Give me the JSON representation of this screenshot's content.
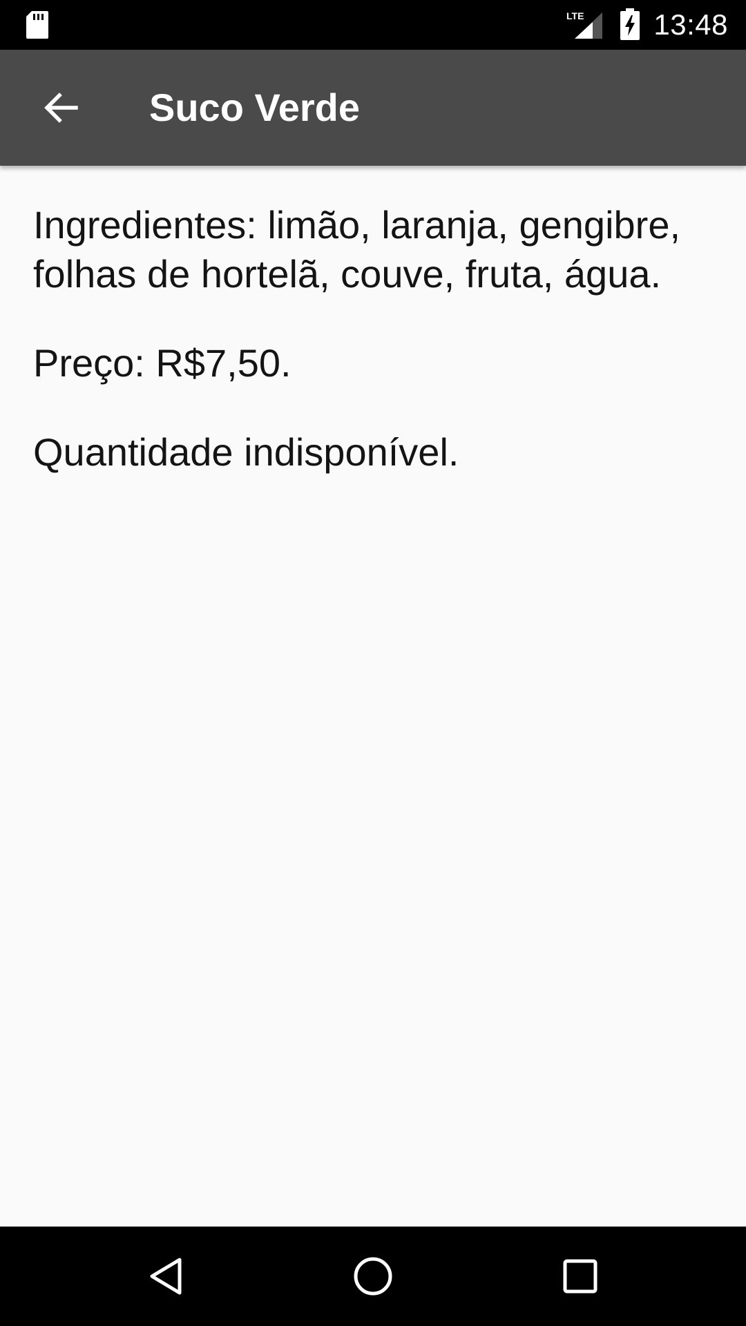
{
  "status_bar": {
    "time": "13:48",
    "network_label": "LTE",
    "icons": [
      "sd-card-icon",
      "lte-signal-icon",
      "battery-charging-icon"
    ]
  },
  "app_bar": {
    "title": "Suco Verde",
    "back_icon": "arrow-left-icon"
  },
  "content": {
    "ingredients": "Ingredientes: limão, laranja, gengibre, folhas de hortelã, couve, fruta, água.",
    "price": "Preço: R$7,50.",
    "availability": "Quantidade indisponível."
  },
  "nav_bar": {
    "icons": [
      "nav-back-icon",
      "nav-home-icon",
      "nav-recents-icon"
    ]
  },
  "colors": {
    "status_bar_bg": "#000000",
    "app_bar_bg": "#4a4a4a",
    "background": "#fafafa",
    "text": "#141414",
    "nav_bar_bg": "#000000"
  }
}
